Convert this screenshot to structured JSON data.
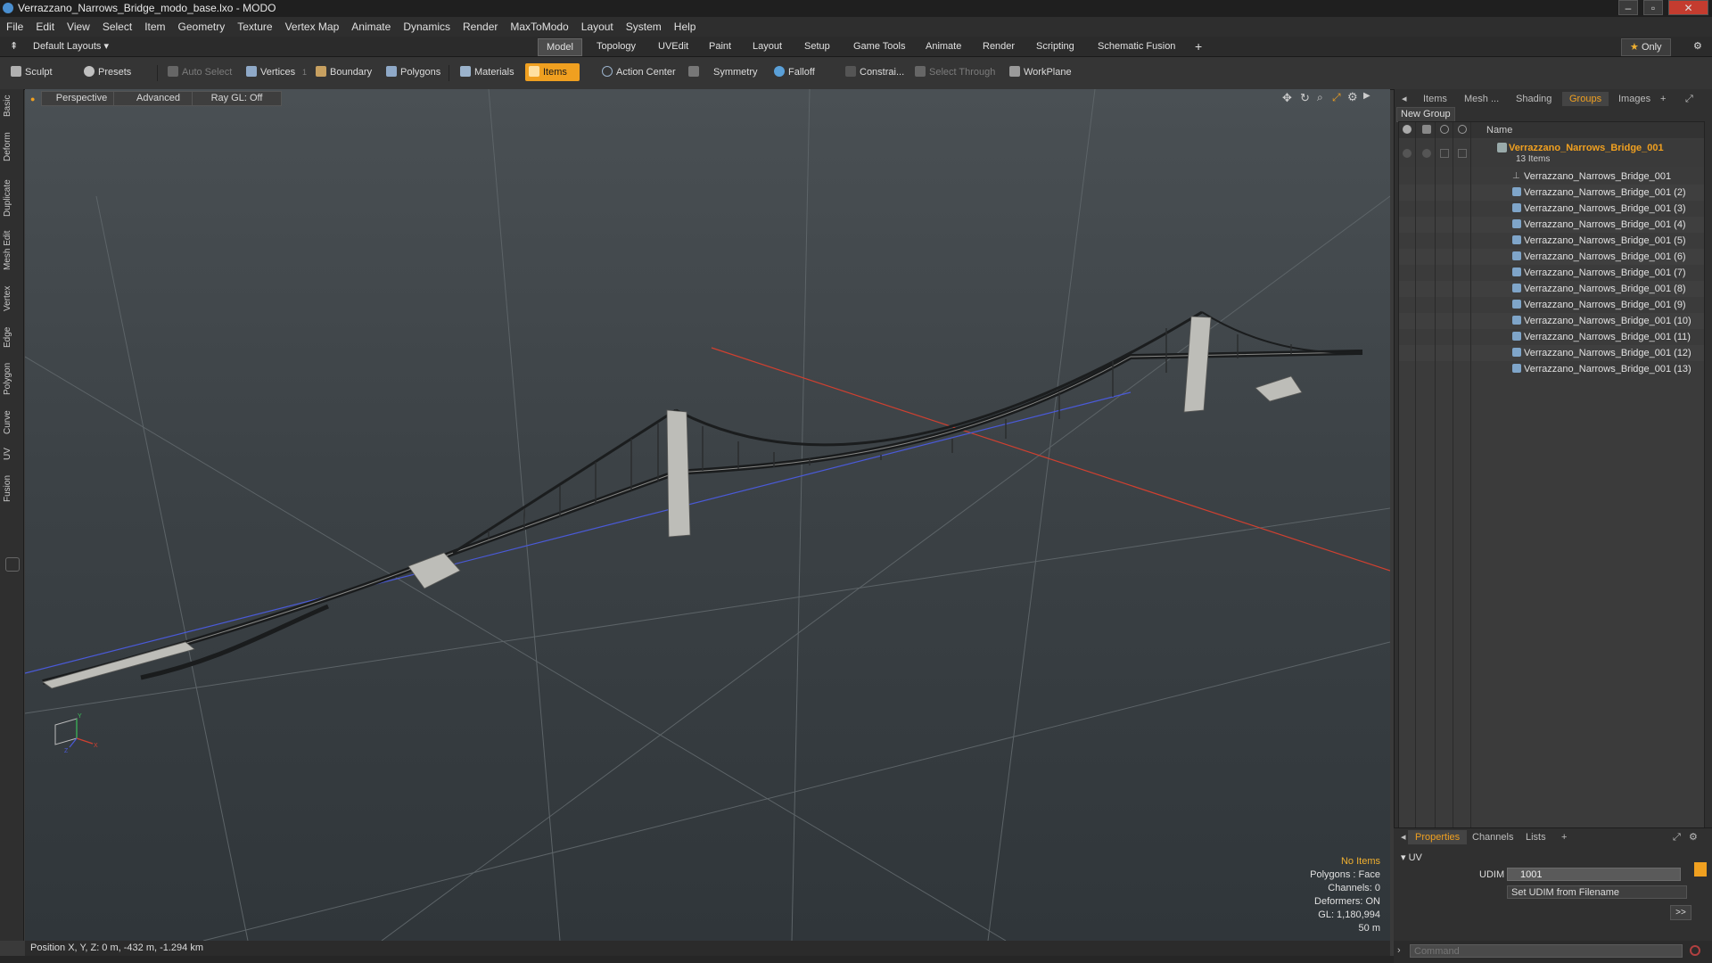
{
  "window": {
    "title": "Verrazzano_Narrows_Bridge_modo_base.lxo - MODO",
    "controls": [
      "–",
      "▫",
      "✕"
    ]
  },
  "menu": [
    "File",
    "Edit",
    "View",
    "Select",
    "Item",
    "Geometry",
    "Texture",
    "Vertex Map",
    "Animate",
    "Dynamics",
    "Render",
    "MaxToModo",
    "Layout",
    "System",
    "Help"
  ],
  "layoutbar": {
    "layouts_label": "Default Layouts",
    "tabs": [
      "Model",
      "Topology",
      "UVEdit",
      "Paint",
      "Layout",
      "Setup",
      "Game Tools",
      "Animate",
      "Render",
      "Scripting",
      "Schematic Fusion"
    ],
    "active_tab": "Model",
    "add": "+",
    "only_label": "Only"
  },
  "toolbar": {
    "sculpt": "Sculpt",
    "presets": "Presets",
    "auto_select": "Auto Select",
    "vertices": "Vertices",
    "vertices_count": "1",
    "boundary": "Boundary",
    "polygons": "Polygons",
    "materials": "Materials",
    "items": "Items",
    "action_center": "Action Center",
    "symmetry": "Symmetry",
    "falloff": "Falloff",
    "constrain": "Constrai...",
    "select_through": "Select Through",
    "workplane": "WorkPlane"
  },
  "left_tabs": [
    "Basic",
    "Deform",
    "Duplicate",
    "Mesh Edit",
    "Vertex",
    "Edge",
    "Polygon",
    "Curve",
    "UV",
    "Fusion"
  ],
  "viewport": {
    "header": {
      "view": "Perspective",
      "shading": "Advanced",
      "raygl": "Ray GL: Off"
    },
    "stats": {
      "selection": "No Items",
      "polygons": "Polygons : Face",
      "channels": "Channels: 0",
      "deformers": "Deformers: ON",
      "gl": "GL: 1,180,994",
      "scale": "50 m"
    },
    "axis": {
      "x": "X",
      "y": "Y",
      "z": "Z"
    }
  },
  "status": {
    "position": "Position X, Y, Z:  0 m, -432 m, -1.294 km"
  },
  "right_panel": {
    "tabs": [
      "Items",
      "Mesh ...",
      "Shading",
      "Groups",
      "Images"
    ],
    "active_tab": "Groups",
    "new_group": "New Group",
    "name_column": "Name",
    "group": {
      "name": "Verrazzano_Narrows_Bridge_001",
      "count": "13 Items",
      "children": [
        "Verrazzano_Narrows_Bridge_001",
        "Verrazzano_Narrows_Bridge_001 (2)",
        "Verrazzano_Narrows_Bridge_001 (3)",
        "Verrazzano_Narrows_Bridge_001 (4)",
        "Verrazzano_Narrows_Bridge_001 (5)",
        "Verrazzano_Narrows_Bridge_001 (6)",
        "Verrazzano_Narrows_Bridge_001 (7)",
        "Verrazzano_Narrows_Bridge_001 (8)",
        "Verrazzano_Narrows_Bridge_001 (9)",
        "Verrazzano_Narrows_Bridge_001 (10)",
        "Verrazzano_Narrows_Bridge_001 (11)",
        "Verrazzano_Narrows_Bridge_001 (12)",
        "Verrazzano_Narrows_Bridge_001 (13)"
      ]
    },
    "bottom_tabs": [
      "Properties",
      "Channels",
      "Lists"
    ],
    "bottom_active": "Properties",
    "properties": {
      "section": "UV",
      "udim_label": "UDIM",
      "udim_value": "1001",
      "set_udim": "Set UDIM from Filename",
      "more": ">>"
    },
    "command_placeholder": "Command"
  },
  "colors": {
    "accent": "#f0a020",
    "x_axis": "#d04030",
    "z_axis": "#4a5ad8",
    "viewport_top": "#4a5054"
  }
}
